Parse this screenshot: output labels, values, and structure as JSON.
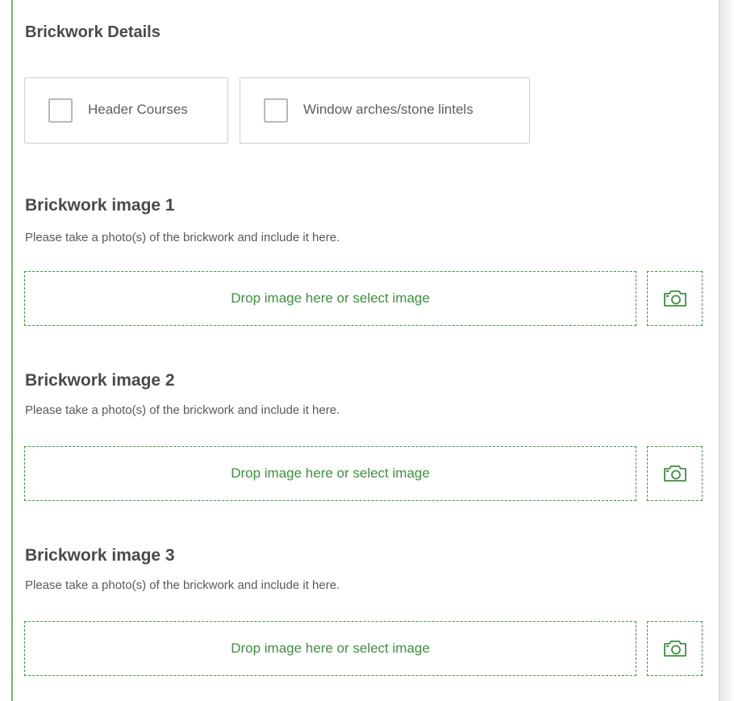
{
  "section": {
    "title": "Brickwork Details"
  },
  "checkboxes": [
    {
      "label": "Header Courses",
      "checked": false
    },
    {
      "label": "Window arches/stone lintels",
      "checked": false
    }
  ],
  "image_fields": [
    {
      "heading": "Brickwork image 1",
      "description": "Please take a photo(s) of the brickwork and include it here.",
      "drop_text": "Drop image here or select image",
      "icon": "camera-icon"
    },
    {
      "heading": "Brickwork image 2",
      "description": "Please take a photo(s) of the brickwork and include it here.",
      "drop_text": "Drop image here or select image",
      "icon": "camera-icon"
    },
    {
      "heading": "Brickwork image 3",
      "description": "Please take a photo(s) of the brickwork and include it here.",
      "drop_text": "Drop image here or select image",
      "icon": "camera-icon"
    }
  ],
  "colors": {
    "accent_green": "#3f9a3f",
    "left_rule": "#78b478",
    "text": "#4a4a4a"
  }
}
